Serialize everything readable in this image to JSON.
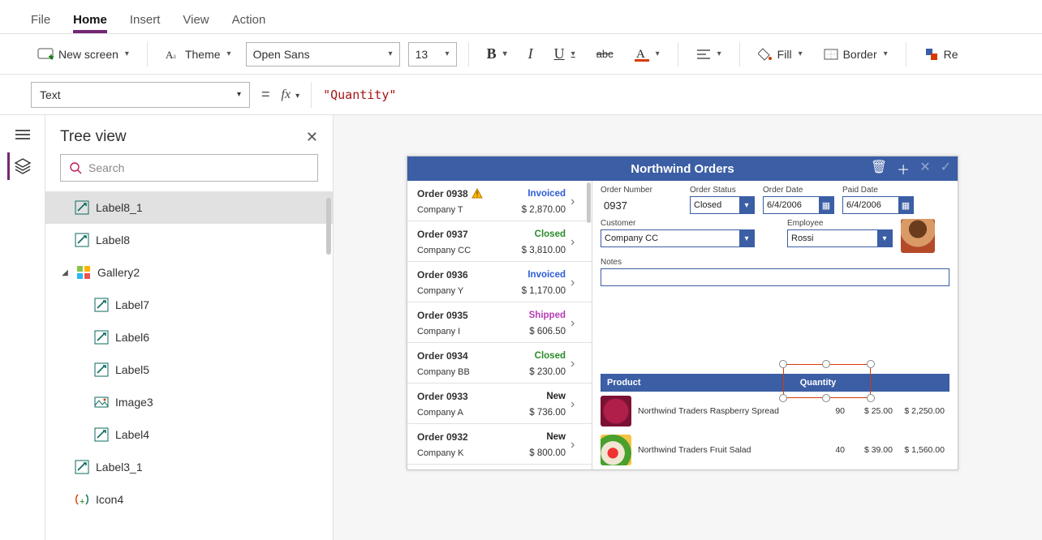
{
  "menubar": {
    "file": "File",
    "home": "Home",
    "insert": "Insert",
    "view": "View",
    "action": "Action"
  },
  "ribbon": {
    "new_screen": "New screen",
    "theme": "Theme",
    "font_name": "Open Sans",
    "font_size": "13",
    "fill": "Fill",
    "border": "Border",
    "reorder": "Re"
  },
  "formula": {
    "property": "Text",
    "equals": "=",
    "fx": "fx",
    "expression": "\"Quantity\""
  },
  "tree": {
    "title": "Tree view",
    "search_placeholder": "Search",
    "items": [
      {
        "name": "Label8_1",
        "kind": "label",
        "depth": 1,
        "selected": true
      },
      {
        "name": "Label8",
        "kind": "label",
        "depth": 1,
        "selected": false
      },
      {
        "name": "Gallery2",
        "kind": "gallery",
        "depth": 0,
        "selected": false,
        "expanded": true
      },
      {
        "name": "Label7",
        "kind": "label",
        "depth": 2,
        "selected": false
      },
      {
        "name": "Label6",
        "kind": "label",
        "depth": 2,
        "selected": false
      },
      {
        "name": "Label5",
        "kind": "label",
        "depth": 2,
        "selected": false
      },
      {
        "name": "Image3",
        "kind": "image",
        "depth": 2,
        "selected": false
      },
      {
        "name": "Label4",
        "kind": "label",
        "depth": 2,
        "selected": false
      },
      {
        "name": "Label3_1",
        "kind": "label",
        "depth": 1,
        "selected": false
      },
      {
        "name": "Icon4",
        "kind": "icon4",
        "depth": 1,
        "selected": false
      }
    ]
  },
  "app": {
    "title": "Northwind Orders",
    "orders": [
      {
        "id": "Order 0938",
        "company": "Company T",
        "status": "Invoiced",
        "status_class": "st-invoiced",
        "amount": "$ 2,870.00",
        "warn": true
      },
      {
        "id": "Order 0937",
        "company": "Company CC",
        "status": "Closed",
        "status_class": "st-closed",
        "amount": "$ 3,810.00",
        "warn": false
      },
      {
        "id": "Order 0936",
        "company": "Company Y",
        "status": "Invoiced",
        "status_class": "st-invoiced",
        "amount": "$ 1,170.00",
        "warn": false
      },
      {
        "id": "Order 0935",
        "company": "Company I",
        "status": "Shipped",
        "status_class": "st-shipped",
        "amount": "$ 606.50",
        "warn": false
      },
      {
        "id": "Order 0934",
        "company": "Company BB",
        "status": "Closed",
        "status_class": "st-closed",
        "amount": "$ 230.00",
        "warn": false
      },
      {
        "id": "Order 0933",
        "company": "Company A",
        "status": "New",
        "status_class": "st-new",
        "amount": "$ 736.00",
        "warn": false
      },
      {
        "id": "Order 0932",
        "company": "Company K",
        "status": "New",
        "status_class": "st-new",
        "amount": "$ 800.00",
        "warn": false
      }
    ],
    "detail": {
      "labels": {
        "order_number": "Order Number",
        "order_status": "Order Status",
        "order_date": "Order Date",
        "paid_date": "Paid Date",
        "customer": "Customer",
        "employee": "Employee",
        "notes": "Notes",
        "product_col": "Product",
        "quantity_col": "Quantity"
      },
      "order_number": "0937",
      "order_status": "Closed",
      "order_date": "6/4/2006",
      "paid_date": "6/4/2006",
      "customer": "Company CC",
      "employee": "Rossi",
      "products": [
        {
          "name": "Northwind Traders Raspberry Spread",
          "thumb": "rasp",
          "qty": "90",
          "price": "$ 25.00",
          "total": "$ 2,250.00"
        },
        {
          "name": "Northwind Traders Fruit Salad",
          "thumb": "salad",
          "qty": "40",
          "price": "$ 39.00",
          "total": "$ 1,560.00"
        }
      ]
    }
  }
}
